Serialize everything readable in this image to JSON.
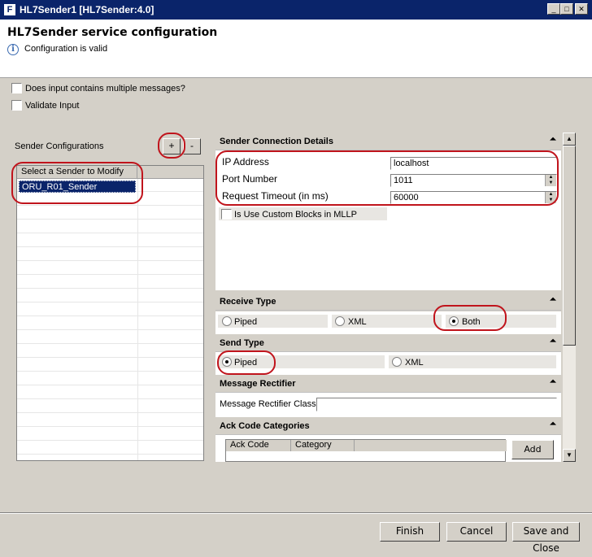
{
  "window": {
    "title": "HL7Sender1 [HL7Sender:4.0]",
    "app_icon": "F",
    "controls": {
      "minimize": "_",
      "maximize": "□",
      "close": "✕"
    }
  },
  "header": {
    "heading": "HL7Sender service configuration",
    "status": "Configuration is valid",
    "status_icon": "i"
  },
  "options": {
    "multiple_messages": {
      "label": "Does input contains multiple messages?",
      "checked": false
    },
    "validate_input": {
      "label": "Validate Input",
      "checked": false
    }
  },
  "sender_configs": {
    "label": "Sender Configurations",
    "add_label": "+",
    "remove_label": "-",
    "column_header": "Select a Sender to Modify",
    "rows": [
      "ORU_R01_Sender"
    ]
  },
  "connection": {
    "title": "Sender Connection Details",
    "ip_label": "IP Address",
    "ip_value": "localhost",
    "port_label": "Port Number",
    "port_value": "1011",
    "timeout_label": "Request Timeout (in ms)",
    "timeout_value": "60000",
    "custom_blocks_label": "Is Use Custom Blocks in MLLP"
  },
  "receive_type": {
    "title": "Receive Type",
    "options": [
      "Piped",
      "XML",
      "Both"
    ],
    "selected": "Both"
  },
  "send_type": {
    "title": "Send Type",
    "options": [
      "Piped",
      "XML"
    ],
    "selected": "Piped"
  },
  "rectifier": {
    "title": "Message Rectifier",
    "class_label": "Message Rectifier Class",
    "class_value": ""
  },
  "ack": {
    "title": "Ack Code Categories",
    "col_code": "Ack Code",
    "col_category": "Category",
    "add_label": "Add"
  },
  "collapse_icon": "⏶",
  "footer": {
    "finish": "Finish",
    "cancel": "Cancel",
    "save_close": "Save and Close"
  },
  "annotation_color": "#c0141c",
  "selection_color": "#0a246a"
}
